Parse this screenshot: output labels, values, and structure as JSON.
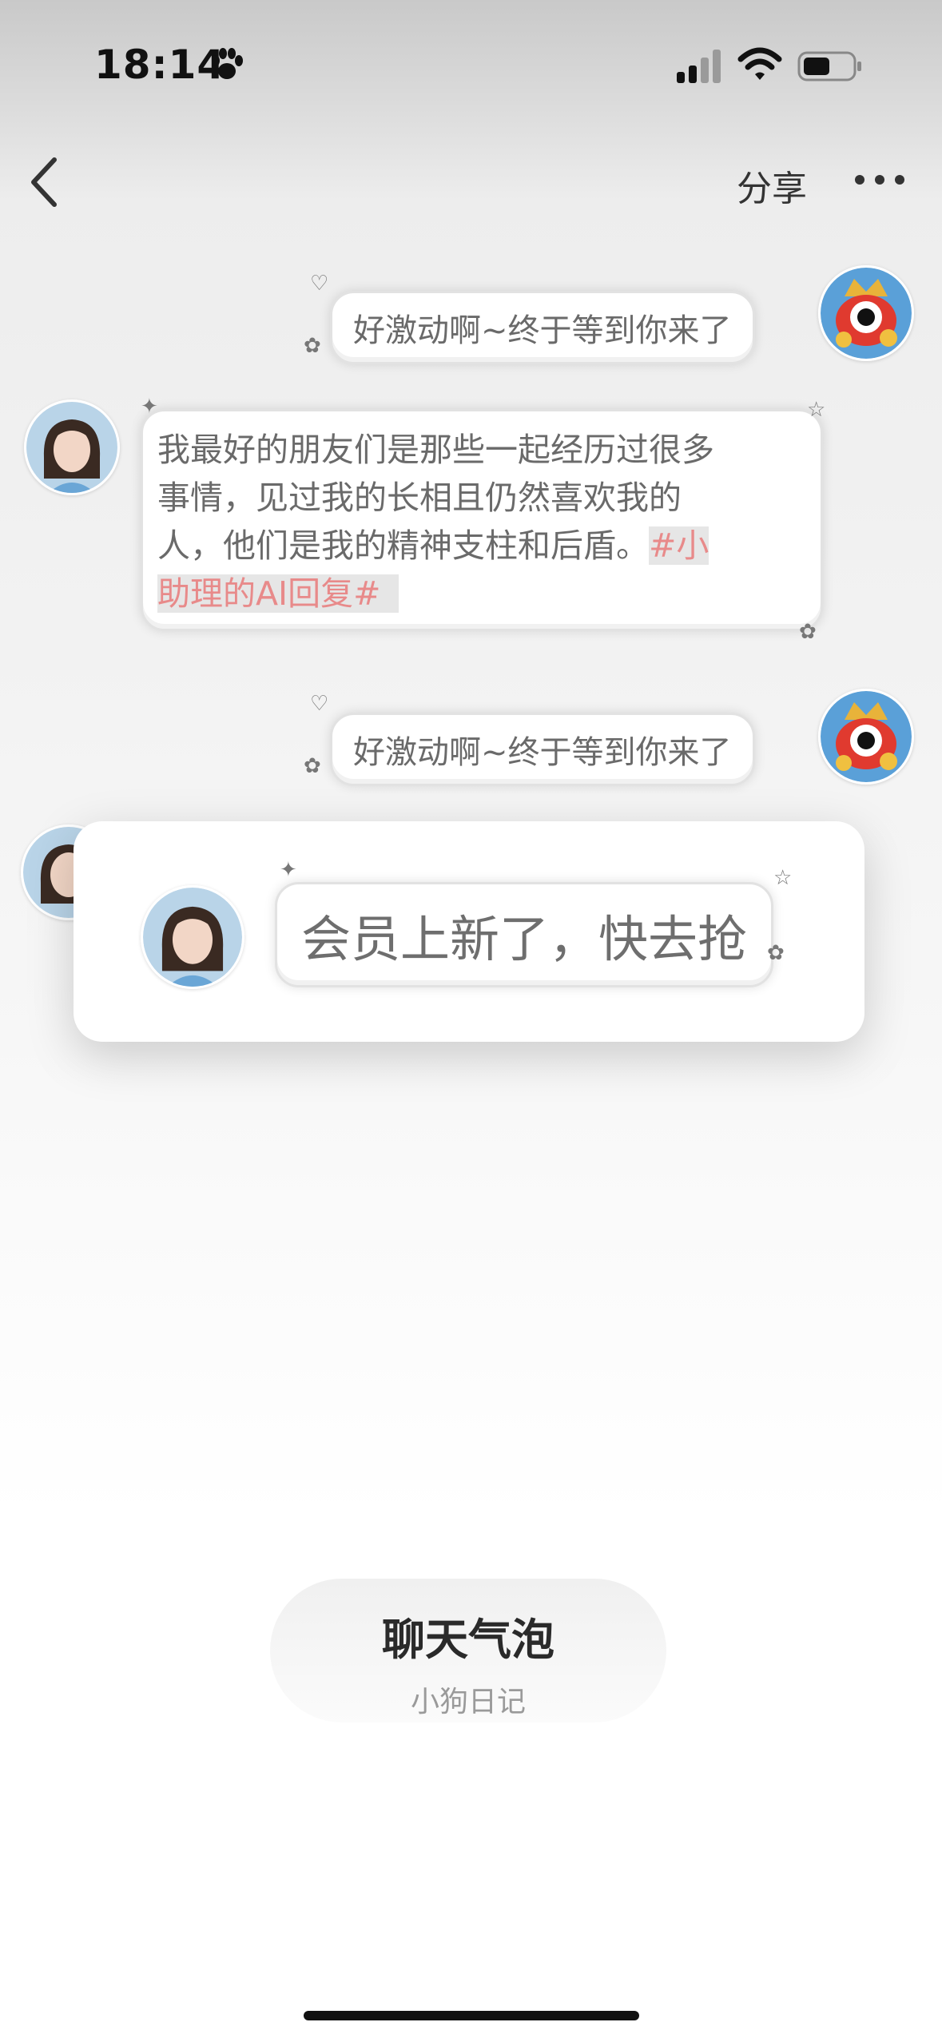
{
  "status_bar": {
    "time": "18:14",
    "icons": [
      "paw-icon",
      "signal-icon",
      "wifi-icon",
      "battery-icon"
    ]
  },
  "nav": {
    "back_icon": "chevron-left-icon",
    "share_label": "分享",
    "more_icon": "more-icon"
  },
  "messages": [
    {
      "side": "right",
      "avatar": "mascot-avatar",
      "text": "好激动啊~终于等到你来了"
    },
    {
      "side": "left",
      "avatar": "girl-avatar",
      "text_line1": "我最好的朋友们是那些一起经历过很多",
      "text_line2": "事情，见过我的长相且仍然喜欢我的",
      "text_line3": "人，他们是我的精神支柱和后盾。",
      "tag_part1": "#小",
      "tag_part2": "助理的AI回复#"
    },
    {
      "side": "right",
      "avatar": "mascot-avatar",
      "text": "好激动啊~终于等到你来了"
    }
  ],
  "popup": {
    "avatar": "girl-avatar",
    "text": "会员上新了，快去抢"
  },
  "info_card": {
    "title": "聊天气泡",
    "subtitle": "小狗日记"
  },
  "colors": {
    "accent_pink": "#e88a8a",
    "bubble_text": "#6a6a6a"
  }
}
